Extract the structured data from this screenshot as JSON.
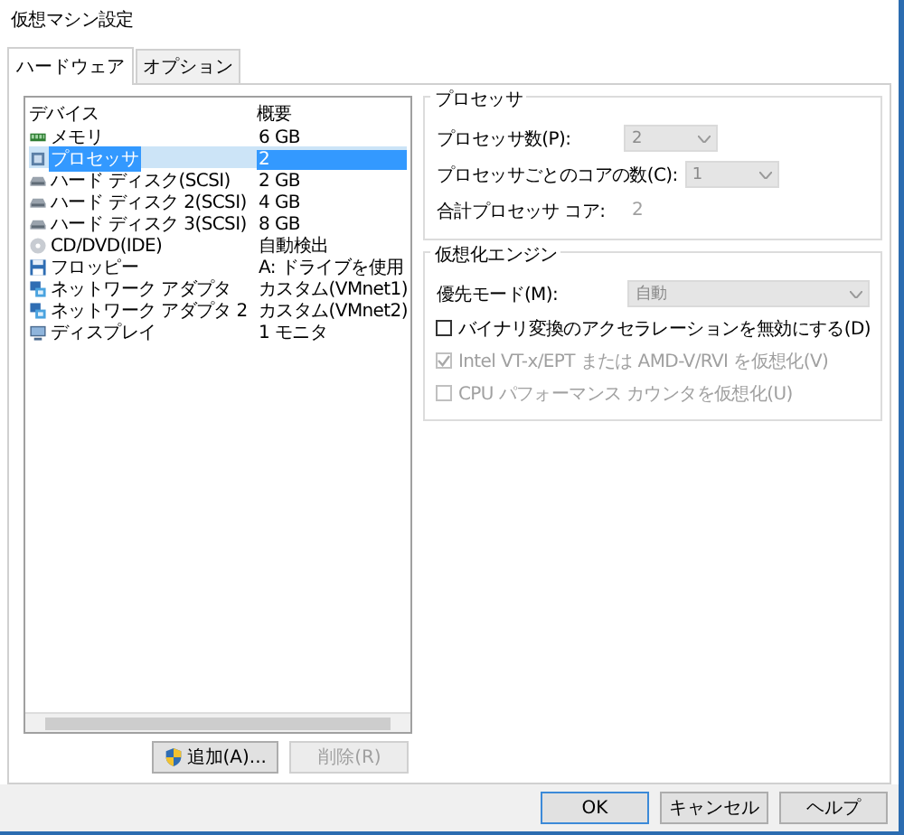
{
  "window": {
    "title": "仮想マシン設定"
  },
  "tabs": [
    {
      "label": "ハードウェア",
      "selected": true
    },
    {
      "label": "オプション",
      "selected": false
    }
  ],
  "devices": {
    "columns": [
      "デバイス",
      "概要"
    ],
    "rows": [
      {
        "kind": "memory",
        "name": "メモリ",
        "summary": "6 GB",
        "selected": false
      },
      {
        "kind": "cpu",
        "name": "プロセッサ",
        "summary": "2",
        "selected": true
      },
      {
        "kind": "disk",
        "name": "ハード ディスク(SCSI)",
        "summary": "2 GB",
        "selected": false
      },
      {
        "kind": "disk",
        "name": "ハード ディスク 2(SCSI)",
        "summary": "4 GB",
        "selected": false
      },
      {
        "kind": "disk",
        "name": "ハード ディスク 3(SCSI)",
        "summary": "8 GB",
        "selected": false
      },
      {
        "kind": "cd",
        "name": "CD/DVD(IDE)",
        "summary": "自動検出",
        "selected": false
      },
      {
        "kind": "floppy",
        "name": "フロッピー",
        "summary": "A: ドライブを使用",
        "selected": false
      },
      {
        "kind": "network",
        "name": "ネットワーク アダプタ",
        "summary": "カスタム(VMnet1)",
        "selected": false
      },
      {
        "kind": "network",
        "name": "ネットワーク アダプタ 2",
        "summary": "カスタム(VMnet2)",
        "selected": false
      },
      {
        "kind": "display",
        "name": "ディスプレイ",
        "summary": "1 モニタ",
        "selected": false
      }
    ]
  },
  "list_buttons": [
    {
      "label": "追加(A)...",
      "shield": true,
      "disabled": false
    },
    {
      "label": "削除(R)",
      "shield": false,
      "disabled": true
    }
  ],
  "processor": {
    "title": "プロセッサ",
    "fields": [
      {
        "kind": "combo",
        "label": "プロセッサ数(P):",
        "value": "2",
        "disabled": true
      },
      {
        "kind": "combo",
        "label": "プロセッサごとのコアの数(C):",
        "value": "1",
        "disabled": true
      },
      {
        "kind": "text",
        "label": "合計プロセッサ コア:",
        "value": "2",
        "disabled": true
      }
    ]
  },
  "virtualization": {
    "title": "仮想化エンジン",
    "mode": {
      "label": "優先モード(M):",
      "value": "自動",
      "disabled": true
    },
    "options": [
      {
        "label": "バイナリ変換のアクセラレーションを無効にする(D)",
        "checked": false,
        "disabled": false
      },
      {
        "label": "Intel VT-x/EPT または AMD-V/RVI を仮想化(V)",
        "checked": true,
        "disabled": true
      },
      {
        "label": "CPU パフォーマンス カウンタを仮想化(U)",
        "checked": false,
        "disabled": true
      }
    ]
  },
  "footer_buttons": [
    {
      "label": "OK",
      "default": true
    },
    {
      "label": "キャンセル",
      "default": false
    },
    {
      "label": "ヘルプ",
      "default": false
    }
  ]
}
